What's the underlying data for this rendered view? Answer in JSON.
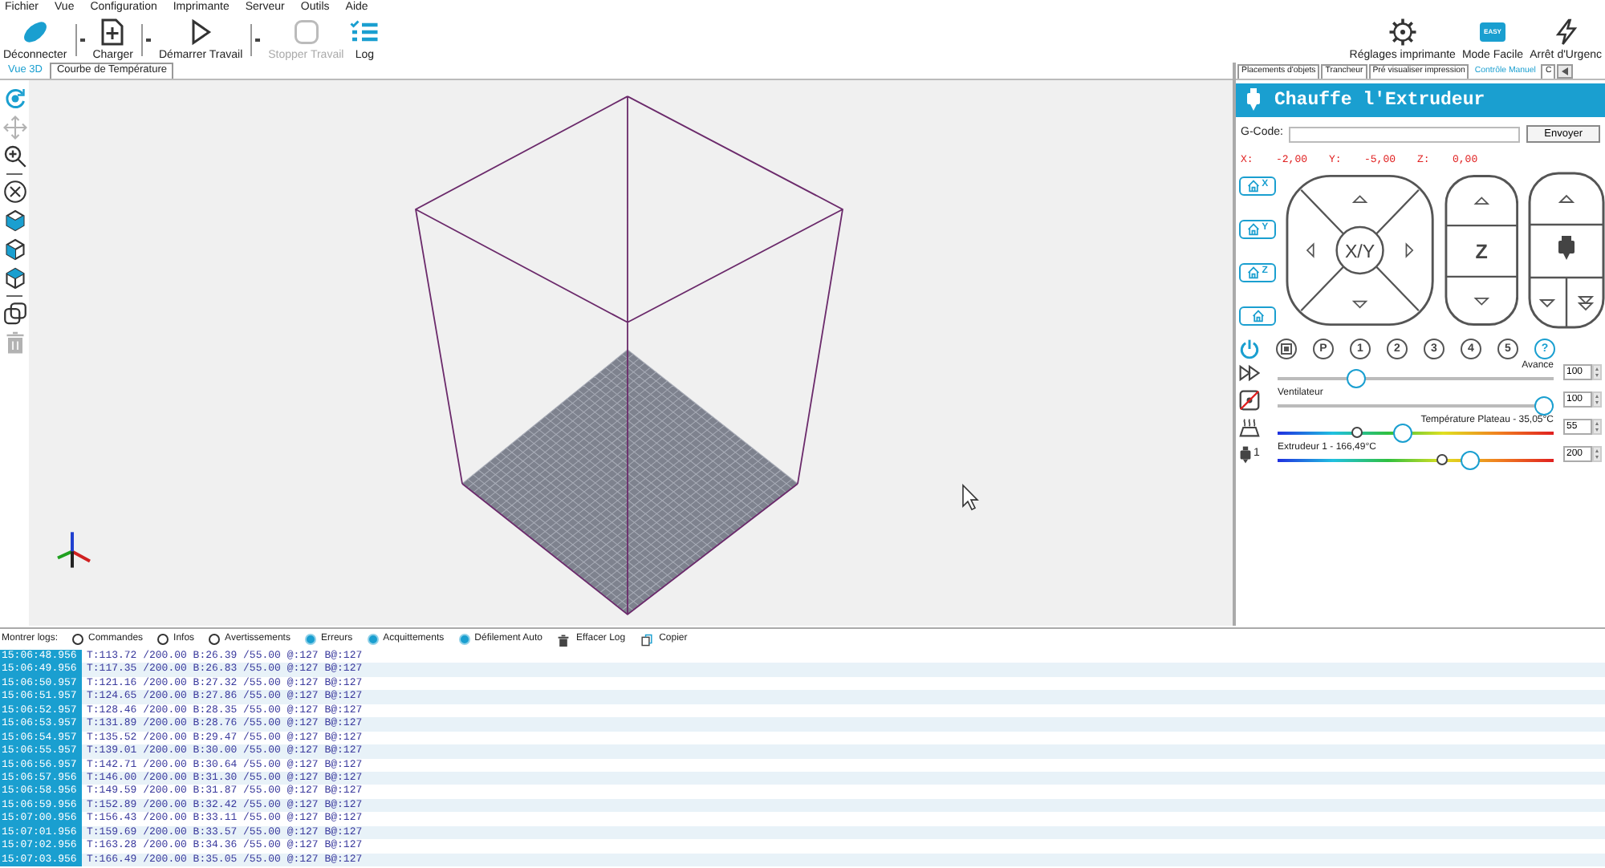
{
  "menu": [
    "Fichier",
    "Vue",
    "Configuration",
    "Imprimante",
    "Serveur",
    "Outils",
    "Aide"
  ],
  "toolbar": [
    {
      "kind": "connect",
      "label": "Déconnecter",
      "dropdown": true,
      "disabled": false
    },
    {
      "kind": "load",
      "label": "Charger",
      "dropdown": true,
      "disabled": false
    },
    {
      "kind": "start",
      "label": "Démarrer Travail",
      "dropdown": true,
      "disabled": false
    },
    {
      "kind": "stop",
      "label": "Stopper Travail",
      "dropdown": false,
      "disabled": true
    },
    {
      "kind": "log",
      "label": "Log",
      "dropdown": false,
      "disabled": false
    }
  ],
  "toolbar_right": [
    {
      "kind": "settings",
      "label": "Réglages imprimante"
    },
    {
      "kind": "easy",
      "label": "Mode Facile",
      "badge": "EASY"
    },
    {
      "kind": "emergency",
      "label": "Arrêt d'Urgenc"
    }
  ],
  "view_tabs": [
    {
      "label": "Vue 3D",
      "selected": true
    },
    {
      "label": "Courbe de Température",
      "selected": false
    }
  ],
  "view_tool_groups": [
    [
      {
        "kind": "rotate",
        "selected": true,
        "disabled": false
      },
      {
        "kind": "move",
        "selected": false,
        "disabled": true
      },
      {
        "kind": "zoom",
        "selected": false,
        "disabled": false
      }
    ],
    [
      {
        "kind": "fit",
        "selected": false,
        "disabled": false
      },
      {
        "kind": "cube_front",
        "selected": false,
        "disabled": false
      },
      {
        "kind": "cube_side",
        "selected": false,
        "disabled": false
      },
      {
        "kind": "cube_top",
        "selected": false,
        "disabled": false
      }
    ],
    [
      {
        "kind": "duplicate",
        "selected": false,
        "disabled": false
      },
      {
        "kind": "delete",
        "selected": false,
        "disabled": true
      }
    ]
  ],
  "control_tabs": [
    {
      "label": "Placements d'objets",
      "selected": false
    },
    {
      "label": "Trancheur",
      "selected": false
    },
    {
      "label": "Pré visualiser impression",
      "selected": false
    },
    {
      "label": "Contrôle Manuel",
      "selected": true
    },
    {
      "label": "C",
      "selected": false
    }
  ],
  "manual_control": {
    "title": "Chauffe l'Extrudeur",
    "gcode": {
      "label": "G-Code:",
      "button": "Envoyer"
    },
    "position": [
      {
        "axis": "X:",
        "value": "-2,00"
      },
      {
        "axis": "Y:",
        "value": "-5,00"
      },
      {
        "axis": "Z:",
        "value": "0,00"
      }
    ],
    "home_buttons": [
      {
        "kind": "axis",
        "label": "X"
      },
      {
        "kind": "axis",
        "label": "Y"
      },
      {
        "kind": "axis",
        "label": "Z"
      },
      {
        "kind": "all"
      }
    ],
    "jog": {
      "xy_label": "X/Y",
      "z_label": "Z"
    },
    "quick_buttons": [
      {
        "kind": "power"
      },
      {
        "kind": "stop"
      },
      {
        "kind": "text",
        "label": "P"
      },
      {
        "kind": "text",
        "label": "1"
      },
      {
        "kind": "text",
        "label": "2"
      },
      {
        "kind": "text",
        "label": "3"
      },
      {
        "kind": "text",
        "label": "4"
      },
      {
        "kind": "text",
        "label": "5"
      },
      {
        "kind": "help",
        "label": "?"
      }
    ],
    "sliders": [
      {
        "kind": "speed",
        "label": "Avance",
        "level": 0.27,
        "value": "100"
      },
      {
        "kind": "fan",
        "label": "Ventilateur",
        "level": 1.0,
        "value": "100"
      },
      {
        "kind": "bed",
        "label": "Température Plateau - 35,05°C",
        "level": 0.45,
        "current": {
          "level": 0.28
        },
        "value": "55"
      },
      {
        "kind": "extruder",
        "icon_index": "1",
        "label": "Extrudeur 1 - 166,49°C",
        "level": 0.71,
        "current": {
          "level": 0.6
        },
        "value": "200"
      }
    ]
  },
  "log": {
    "label": "Montrer logs:",
    "filters": [
      {
        "label": "Commandes",
        "checked": false
      },
      {
        "label": "Infos",
        "checked": false
      },
      {
        "label": "Avertissements",
        "checked": false
      },
      {
        "label": "Erreurs",
        "checked": true
      },
      {
        "label": "Acquittements",
        "checked": true
      },
      {
        "label": "Défilement Auto",
        "checked": true
      }
    ],
    "actions": [
      {
        "kind": "clear",
        "label": "Effacer Log"
      },
      {
        "kind": "copy",
        "label": "Copier"
      }
    ],
    "rows": [
      {
        "time": "15:06:48.956",
        "text": "T:113.72 /200.00 B:26.39 /55.00 @:127 B@:127"
      },
      {
        "time": "15:06:49.956",
        "text": "T:117.35 /200.00 B:26.83 /55.00 @:127 B@:127"
      },
      {
        "time": "15:06:50.957",
        "text": "T:121.16 /200.00 B:27.32 /55.00 @:127 B@:127"
      },
      {
        "time": "15:06:51.957",
        "text": "T:124.65 /200.00 B:27.86 /55.00 @:127 B@:127"
      },
      {
        "time": "15:06:52.957",
        "text": "T:128.46 /200.00 B:28.35 /55.00 @:127 B@:127"
      },
      {
        "time": "15:06:53.957",
        "text": "T:131.89 /200.00 B:28.76 /55.00 @:127 B@:127"
      },
      {
        "time": "15:06:54.957",
        "text": "T:135.52 /200.00 B:29.47 /55.00 @:127 B@:127"
      },
      {
        "time": "15:06:55.957",
        "text": "T:139.01 /200.00 B:30.00 /55.00 @:127 B@:127"
      },
      {
        "time": "15:06:56.957",
        "text": "T:142.71 /200.00 B:30.64 /55.00 @:127 B@:127"
      },
      {
        "time": "15:06:57.956",
        "text": "T:146.00 /200.00 B:31.30 /55.00 @:127 B@:127"
      },
      {
        "time": "15:06:58.956",
        "text": "T:149.59 /200.00 B:31.87 /55.00 @:127 B@:127"
      },
      {
        "time": "15:06:59.956",
        "text": "T:152.89 /200.00 B:32.42 /55.00 @:127 B@:127"
      },
      {
        "time": "15:07:00.956",
        "text": "T:156.43 /200.00 B:33.11 /55.00 @:127 B@:127"
      },
      {
        "time": "15:07:01.956",
        "text": "T:159.69 /200.00 B:33.57 /55.00 @:127 B@:127"
      },
      {
        "time": "15:07:02.956",
        "text": "T:163.28 /200.00 B:34.36 /55.00 @:127 B@:127"
      },
      {
        "time": "15:07:03.956",
        "text": "T:166.49 /200.00 B:35.05 /55.00 @:127 B@:127"
      }
    ]
  }
}
